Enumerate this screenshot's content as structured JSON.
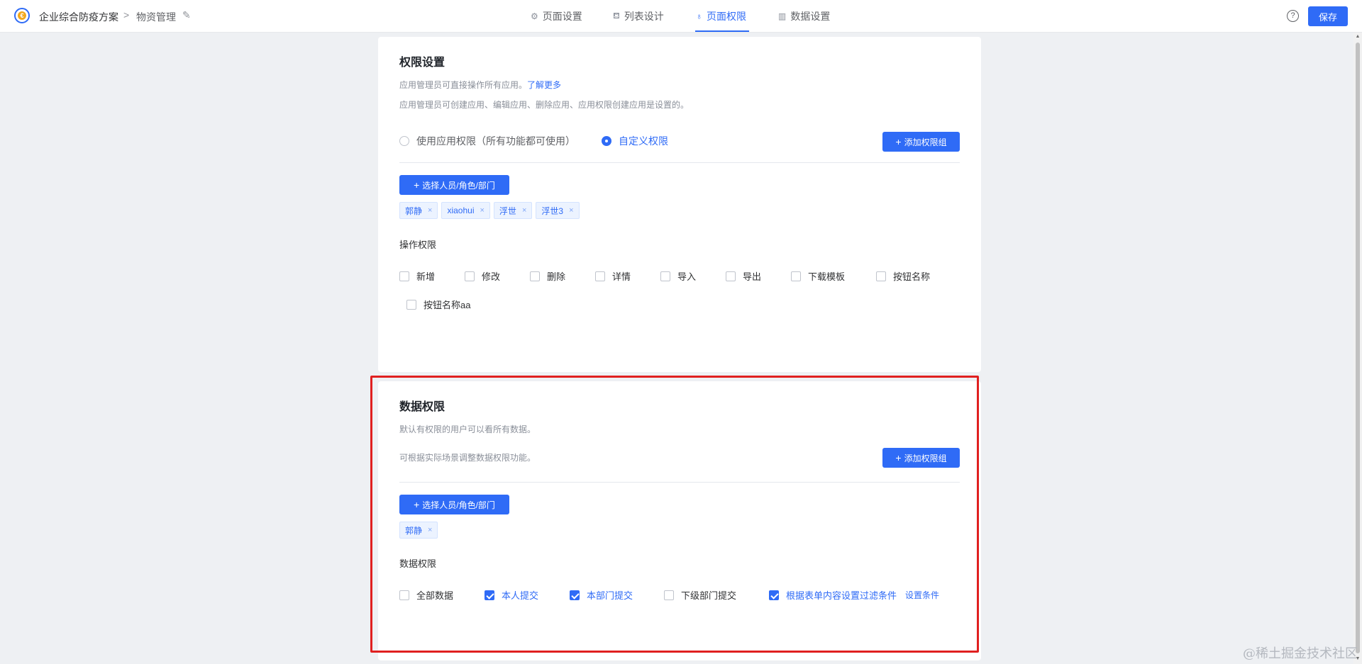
{
  "header": {
    "app_name": "企业综合防疫方案",
    "separator": ">",
    "page_name": "物资管理",
    "edit_glyph": "✎",
    "logo_glyph": "€",
    "help_glyph": "?",
    "save_label": "保存",
    "tabs": [
      {
        "label": "页面设置",
        "icon": "settings-icon",
        "glyph": "⚙",
        "active": false
      },
      {
        "label": "列表设计",
        "icon": "list-design-icon",
        "glyph": "⛾",
        "active": false
      },
      {
        "label": "页面权限",
        "icon": "permission-icon",
        "glyph": "♁",
        "active": true
      },
      {
        "label": "数据设置",
        "icon": "bar-chart-icon",
        "glyph": "▥",
        "active": false
      }
    ]
  },
  "permission_settings": {
    "title": "权限设置",
    "desc1": "应用管理员可直接操作所有应用。",
    "learn_more": "了解更多",
    "desc2": "应用管理员可创建应用、编辑应用、删除应用、应用权限创建应用是设置的。",
    "radio_options": [
      {
        "label": "使用应用权限（所有功能都可使用）",
        "checked": false
      },
      {
        "label": "自定义权限",
        "checked": true
      }
    ],
    "add_group_label": "添加权限组",
    "select_members_label": "选择人员/角色/部门",
    "tags": [
      "郭静",
      "xiaohui",
      "浮世",
      "浮世3"
    ],
    "operations_label": "操作权限",
    "operations": [
      {
        "label": "新增",
        "checked": false
      },
      {
        "label": "修改",
        "checked": false
      },
      {
        "label": "删除",
        "checked": false
      },
      {
        "label": "详情",
        "checked": false
      },
      {
        "label": "导入",
        "checked": false
      },
      {
        "label": "导出",
        "checked": false
      },
      {
        "label": "下载模板",
        "checked": false
      },
      {
        "label": "按钮名称",
        "checked": false
      },
      {
        "label": "按钮名称aa",
        "checked": false
      }
    ]
  },
  "data_permissions": {
    "title": "数据权限",
    "desc1": "默认有权限的用户可以看所有数据。",
    "desc2": "可根据实际场景调整数据权限功能。",
    "add_group_label": "添加权限组",
    "select_members_label": "选择人员/角色/部门",
    "tags": [
      "郭静"
    ],
    "section_label": "数据权限",
    "options": [
      {
        "label": "全部数据",
        "checked": false
      },
      {
        "label": "本人提交",
        "checked": true
      },
      {
        "label": "本部门提交",
        "checked": true
      },
      {
        "label": "下级部门提交",
        "checked": false
      },
      {
        "label": "根据表单内容设置过滤条件",
        "checked": true
      }
    ],
    "set_condition_label": "设置条件"
  },
  "tag_close_glyph": "×",
  "plus_glyph": "+",
  "watermark": "@稀土掘金技术社区",
  "colors": {
    "accent": "#2f6bf6",
    "highlight_border": "#e02020",
    "background": "#eef0f3"
  }
}
